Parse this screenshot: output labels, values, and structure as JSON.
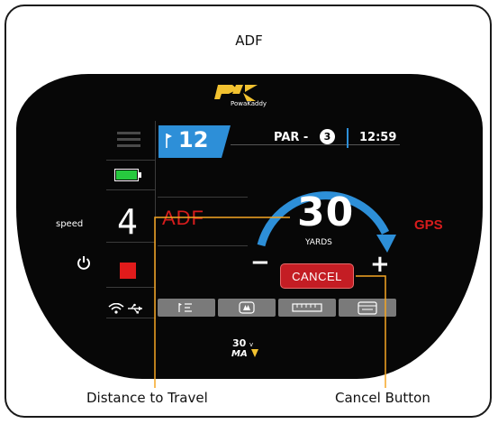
{
  "figure": {
    "title": "ADF",
    "callouts": {
      "distance": "Distance to Travel",
      "cancel": "Cancel Button"
    }
  },
  "device": {
    "brand_logo": "PowaKaddy",
    "model_badge": "30v MAX"
  },
  "sidebar": {
    "speed_label": "speed",
    "speed_value": "4",
    "battery_level": 1.0,
    "icons": [
      "menu-icon",
      "battery-icon",
      "power-icon",
      "stop-icon",
      "wifi-icon",
      "usb-icon"
    ]
  },
  "screen": {
    "hole_number": "12",
    "par_label": "PAR -",
    "par_value": "3",
    "time": "12:59",
    "distance_value": "30",
    "distance_unit": "YARDS",
    "mode_left": "ADF",
    "mode_right": "GPS",
    "minus_label": "−",
    "plus_label": "+",
    "cancel_label": "CANCEL",
    "tabs": [
      "hole-info-icon",
      "trees-icon",
      "ruler-icon",
      "scorecard-icon"
    ]
  },
  "colors": {
    "accent_blue": "#2d8fd8",
    "mode_red": "#d61c1c",
    "cancel_red": "#c41d24",
    "callout_orange": "#f5a623",
    "battery_green": "#27c93f"
  }
}
